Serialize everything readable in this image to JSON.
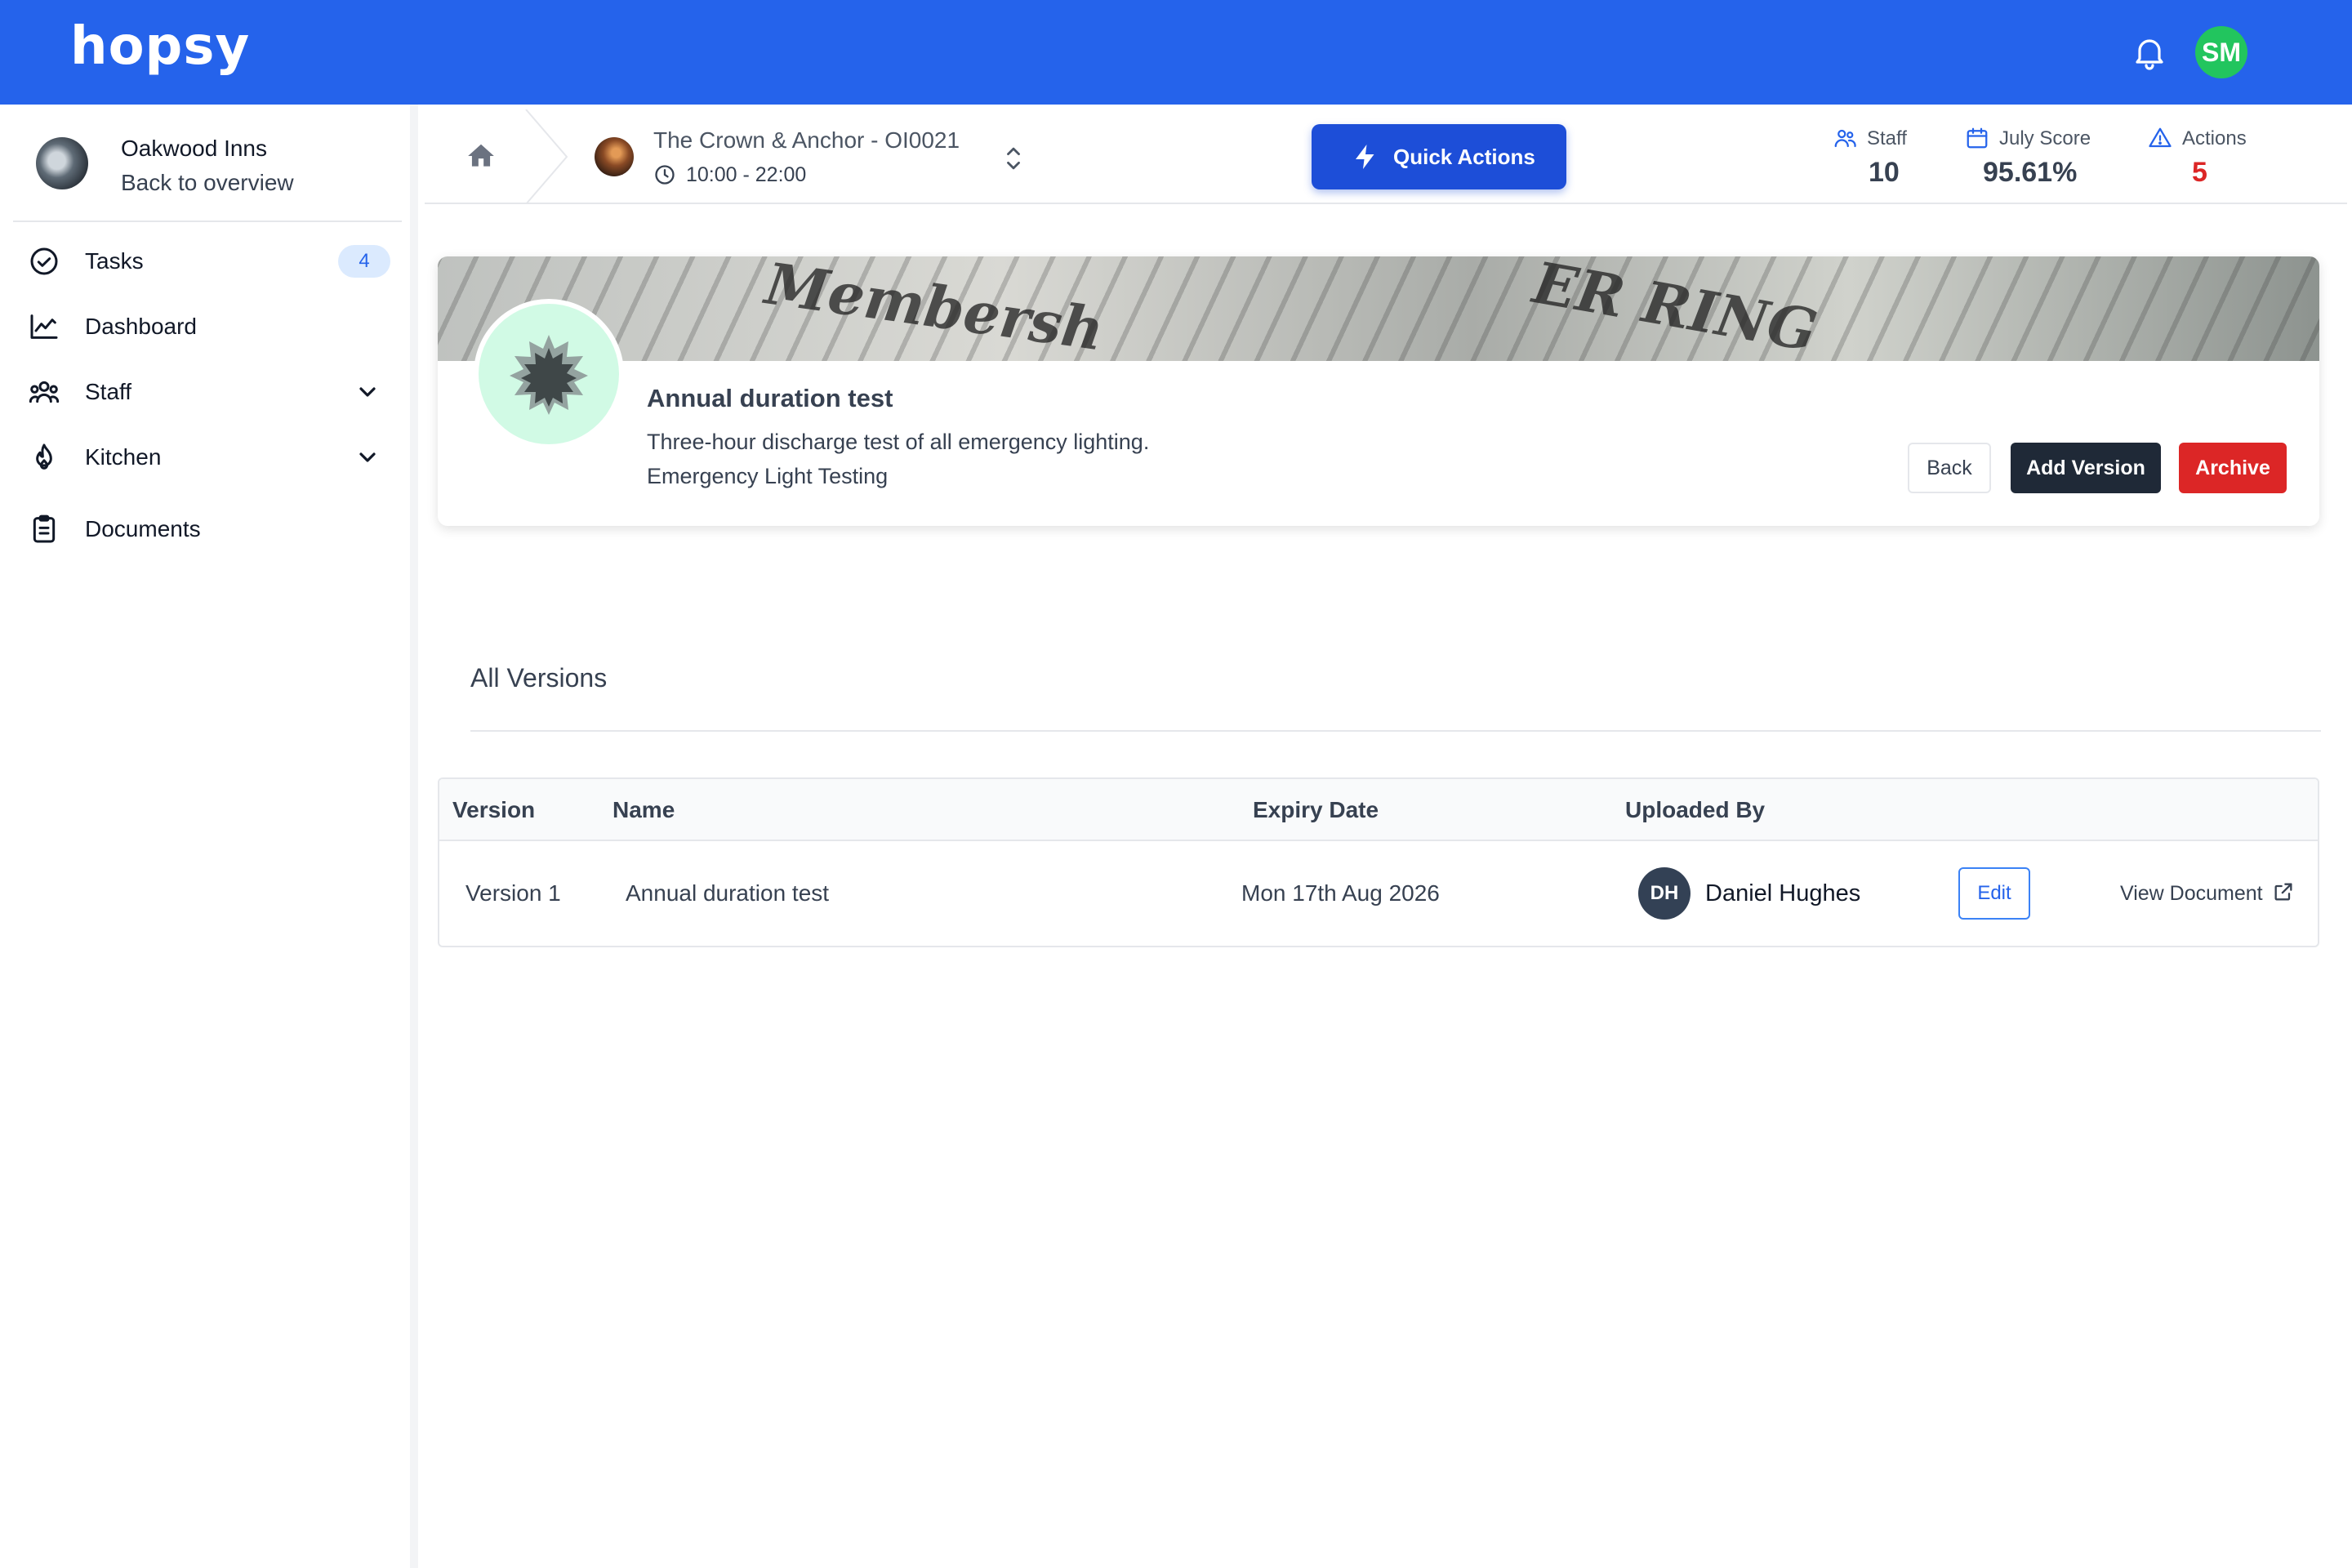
{
  "app": {
    "logo": "hopsy",
    "user_initials": "SM",
    "accent": "#2563eb",
    "user_avatar_color": "#22c55e"
  },
  "sidebar": {
    "org_name": "Oakwood Inns",
    "back_label": "Back to overview",
    "items": [
      {
        "label": "Tasks",
        "icon": "check-circle-icon",
        "badge": "4"
      },
      {
        "label": "Dashboard",
        "icon": "chart-line-icon"
      },
      {
        "label": "Staff",
        "icon": "users-icon",
        "expandable": true
      },
      {
        "label": "Kitchen",
        "icon": "flame-icon",
        "expandable": true
      },
      {
        "label": "Documents",
        "icon": "clipboard-icon"
      }
    ]
  },
  "header": {
    "site_name": "The Crown & Anchor - OI0021",
    "site_hours": "10:00 - 22:00",
    "quick_actions_label": "Quick Actions",
    "stats": [
      {
        "label": "Staff",
        "value": "10",
        "icon": "users-icon"
      },
      {
        "label": "July Score",
        "value": "95.61%",
        "icon": "calendar-icon"
      },
      {
        "label": "Actions",
        "value": "5",
        "icon": "warning-icon",
        "value_color": "#dc2626"
      }
    ]
  },
  "document": {
    "title": "Annual duration test",
    "description": "Three-hour discharge test of all emergency lighting.",
    "category": "Emergency Light Testing",
    "buttons": {
      "back": "Back",
      "add_version": "Add Version",
      "archive": "Archive"
    }
  },
  "versions": {
    "title": "All Versions",
    "columns": [
      "Version",
      "Name",
      "Expiry Date",
      "Uploaded By"
    ],
    "rows": [
      {
        "version": "Version 1",
        "name": "Annual duration test",
        "expiry": "Mon 17th Aug 2026",
        "uploader_initials": "DH",
        "uploader": "Daniel Hughes",
        "edit_label": "Edit",
        "view_label": "View Document"
      }
    ]
  }
}
